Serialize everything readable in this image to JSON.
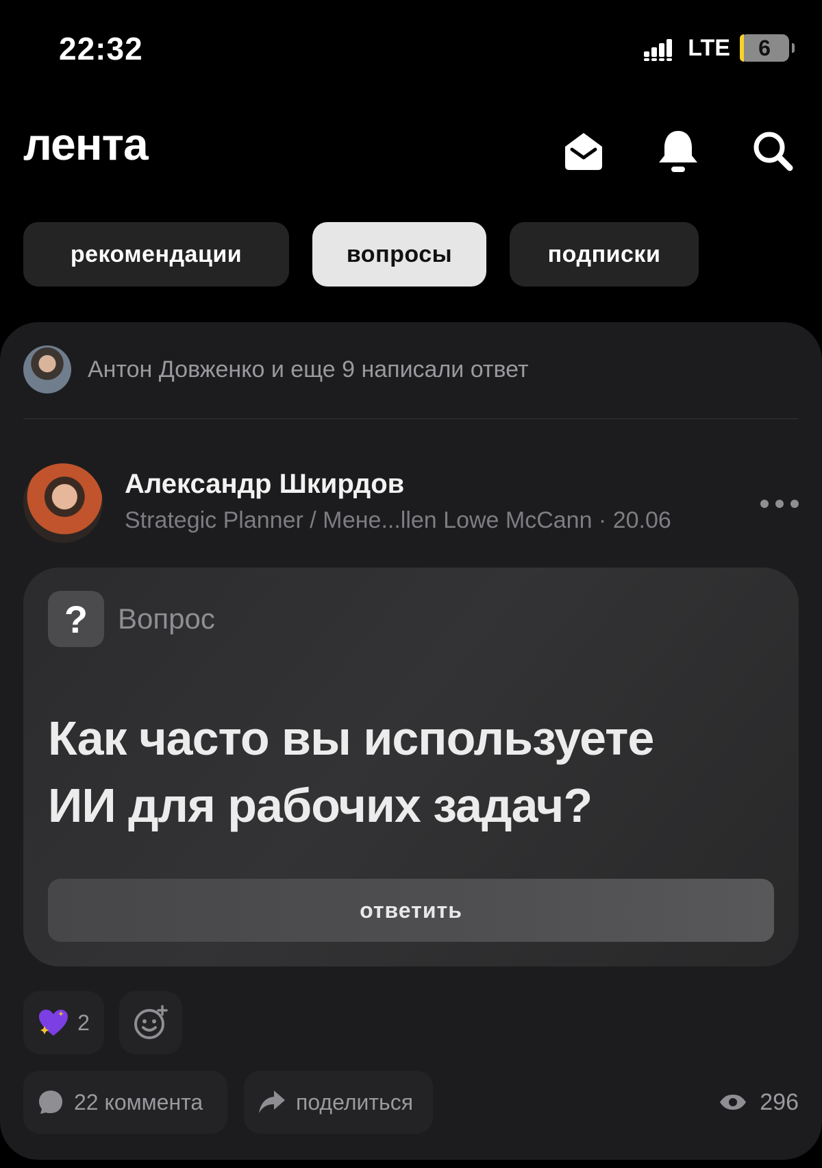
{
  "status_bar": {
    "time": "22:32",
    "network": "LTE",
    "battery": "6",
    "battery_color": "#f6d22a"
  },
  "header": {
    "title": "лента",
    "icons": [
      "mail-icon",
      "bell-icon",
      "search-icon"
    ]
  },
  "tabs": [
    {
      "label": "рекомендации",
      "active": false
    },
    {
      "label": "вопросы",
      "active": true
    },
    {
      "label": "подписки",
      "active": false
    }
  ],
  "post": {
    "activity_text": "Антон Довженко и еще 9 написали ответ",
    "author_name": "Александр Шкирдов",
    "author_meta": "Strategic Planner / Мене...llen Lowe McCann · 20.06",
    "question_label": "Вопрос",
    "question_icon": "?",
    "question_text": "Как часто вы используете ИИ для рабочих задач?",
    "answer_button": "ответить",
    "reactions": {
      "heart_count": "2"
    },
    "comments_label": "22 коммента",
    "share_label": "поделиться",
    "views": "296"
  },
  "colors": {
    "background": "#000000",
    "card": "#1c1c1e",
    "active_tab": "#e6e6e6",
    "heart": "#7b3fe4"
  }
}
